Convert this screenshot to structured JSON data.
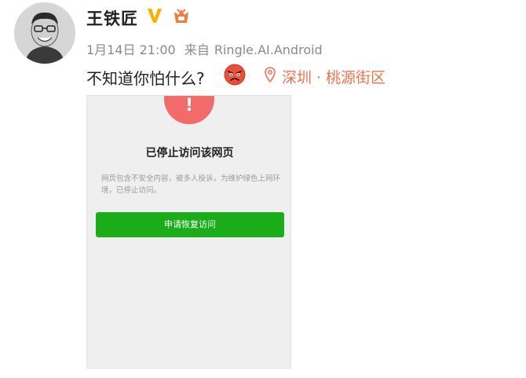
{
  "post": {
    "author": "王铁匠",
    "date": "1月14日 21:00",
    "source_prefix": "来自",
    "source": "Ringle.AI.Android",
    "text": "不知道你怕什么?",
    "location": "深圳 · 桃源街区"
  },
  "embedded_screen": {
    "warning_glyph": "!",
    "title": "已停止访问该网页",
    "description": "网页包含不安全内容，被多人投诉，为维护绿色上网环境，已停止访问。",
    "button_label": "申请恢复访问"
  },
  "colors": {
    "accent_location": "#eb7350",
    "verified": "#f6b200",
    "warning_red": "#f26b6b",
    "button_green": "#1aad19"
  },
  "icons": [
    "avatar",
    "verified-icon",
    "vip-icon",
    "angry-emoji-icon",
    "location-pin-icon",
    "warning-icon"
  ]
}
